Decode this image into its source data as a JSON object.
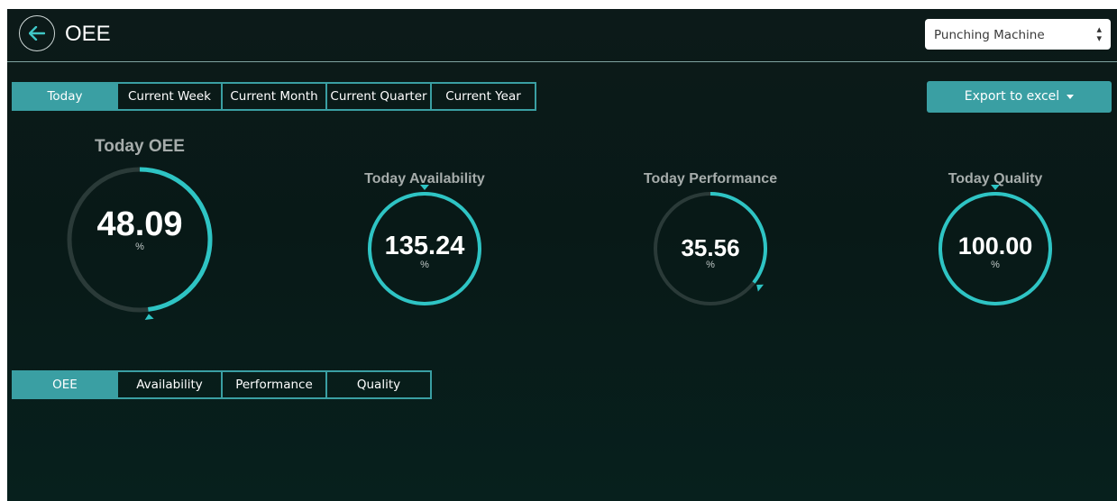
{
  "header": {
    "title": "OEE",
    "back_icon": "back-arrow-icon",
    "machine_select": {
      "value": "Punching Machine",
      "options": [
        "Punching Machine"
      ]
    }
  },
  "period_tabs": [
    {
      "label": "Today",
      "active": true
    },
    {
      "label": "Current Week",
      "active": false
    },
    {
      "label": "Current Month",
      "active": false
    },
    {
      "label": "Current Quarter",
      "active": false
    },
    {
      "label": "Current Year",
      "active": false
    }
  ],
  "export": {
    "label": "Export to excel"
  },
  "gauges": [
    {
      "title": "Today OEE",
      "value": "48.09",
      "unit": "%",
      "fraction": 0.4809
    },
    {
      "title": "Today Availability",
      "value": "135.24",
      "unit": "%",
      "fraction": 1.0
    },
    {
      "title": "Today Performance",
      "value": "35.56",
      "unit": "%",
      "fraction": 0.3556
    },
    {
      "title": "Today Quality",
      "value": "100.00",
      "unit": "%",
      "fraction": 1.0
    }
  ],
  "metric_tabs": [
    {
      "label": "OEE",
      "active": true
    },
    {
      "label": "Availability",
      "active": false
    },
    {
      "label": "Performance",
      "active": false
    },
    {
      "label": "Quality",
      "active": false
    }
  ],
  "colors": {
    "accent": "#3a9fa3",
    "gauge_progress": "#2ec4c4",
    "gauge_track": "#2a3a38",
    "gauge_title": "#a6acab"
  }
}
